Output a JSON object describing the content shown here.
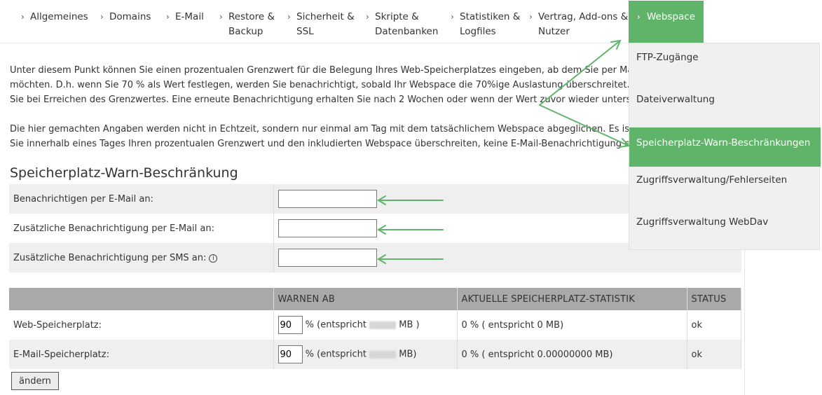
{
  "nav": {
    "items": [
      {
        "label": "Allgemeines"
      },
      {
        "label": "Domains"
      },
      {
        "label": "E-Mail"
      },
      {
        "label": "Restore &",
        "label2": "Backup"
      },
      {
        "label": "Sicherheit &",
        "label2": "SSL"
      },
      {
        "label": "Skripte &",
        "label2": "Datenbanken"
      },
      {
        "label": "Statistiken &",
        "label2": "Logfiles"
      },
      {
        "label": "Vertrag, Add-ons &",
        "label2": "Nutzer"
      },
      {
        "label": "Webspace"
      }
    ]
  },
  "intro": {
    "p1_l1": "Unter diesem Punkt können Sie einen prozentualen Grenzwert für die Belegung Ihres Web-Speicherplatzes eingeben, ab dem Sie per Mail bena",
    "p1_l2": "möchten. D.h. wenn Sie 70 % als Wert festlegen, werden Sie benachrichtigt, sobald Ihr Webspace die 70%ige Auslastung überschreitet. Eine Ber",
    "p1_l3": "Sie bei Erreichen des Grenzwertes. Eine erneute Benachrichtigung erhalten Sie nach 2 Wochen oder wenn der Wert zuvor wieder unterschritte",
    "p2_l1": "Die hier gemachten Angaben werden nicht in Echtzeit, sondern nur einmal am Tag mit dem tatsächlichem Webspace abgeglichen. Es ist also r",
    "p2_l2": "Sie innerhalb eines Tages Ihren prozentualen Grenzwert und den inkludierten Webspace überschreiten, keine E-Mail-Benachrichtigung erhalte"
  },
  "section": {
    "title": "Speicherplatz-Warn-Beschränkung"
  },
  "form": {
    "email_label": "Benachrichtigen per E-Mail an:",
    "email_value": "",
    "email2_label": "Zusätzliche Benachrichtigung per E-Mail an:",
    "email2_value": "",
    "sms_label": "Zusätzliche Benachrichtigung per SMS an:",
    "sms_value": "",
    "info_glyph": "i"
  },
  "stats": {
    "headers": [
      "",
      "WARNEN AB",
      "AKTUELLE SPEICHERPLATZ-STATISTIK",
      "STATUS"
    ],
    "rows": [
      {
        "name": "Web-Speicherplatz:",
        "warn_value": "90",
        "warn_pre": "% (entspricht",
        "warn_post": "MB )",
        "stat": "0 % ( entspricht 0 MB)",
        "status": "ok"
      },
      {
        "name": "E-Mail-Speicherplatz:",
        "warn_value": "90",
        "warn_pre": "% (entspricht",
        "warn_post": "MB)",
        "stat": "0 % ( entspricht 0.00000000 MB)",
        "status": "ok"
      }
    ]
  },
  "button": {
    "label": "ändern"
  },
  "dropdown": {
    "items": [
      {
        "label": "FTP-Zugänge"
      },
      {
        "label": "Dateiverwaltung"
      },
      {
        "label": "Speicherplatz-Warn-Beschränkungen"
      },
      {
        "label": "Zugriffsverwaltung/Fehlerseiten"
      },
      {
        "label": "Zugriffsverwaltung WebDav"
      }
    ]
  },
  "colors": {
    "accent": "#5fb46a",
    "arrow": "#5fb46a",
    "header_gray": "#a9a9a9"
  },
  "icons": {
    "chevron": "chevron-right-icon",
    "info": "info-icon"
  }
}
